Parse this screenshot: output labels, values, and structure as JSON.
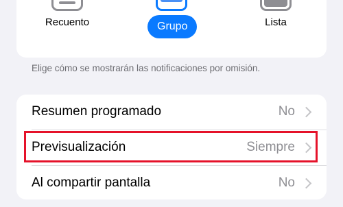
{
  "style_options": [
    {
      "label": "Recuento",
      "selected": false
    },
    {
      "label": "Grupo",
      "selected": true
    },
    {
      "label": "Lista",
      "selected": false
    }
  ],
  "footnote": "Elige cómo se mostrarán las notificaciones por omisión.",
  "rows": [
    {
      "label": "Resumen programado",
      "value": "No"
    },
    {
      "label": "Previsualización",
      "value": "Siempre",
      "highlighted": true
    },
    {
      "label": "Al compartir pantalla",
      "value": "No"
    }
  ],
  "colors": {
    "accent": "#0a7aff",
    "highlight": "#e5122a"
  }
}
